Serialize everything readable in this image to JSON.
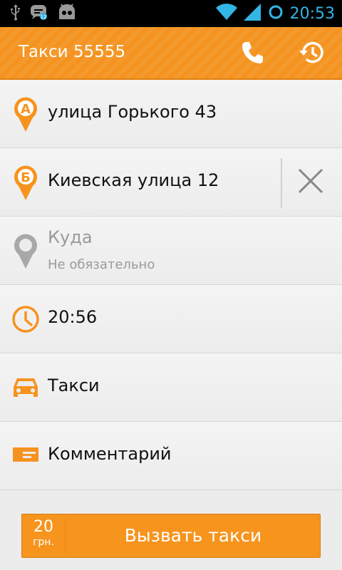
{
  "status_bar": {
    "time": "20:53",
    "icons": [
      "usb-icon",
      "chat-notification-icon",
      "android-icon",
      "wifi-icon",
      "signal-icon",
      "sync-icon"
    ]
  },
  "action_bar": {
    "title": "Такси 55555",
    "actions": [
      "phone-icon",
      "history-icon"
    ]
  },
  "rows": {
    "from": {
      "badge": "А",
      "text": "улица Горького 43"
    },
    "via": {
      "badge": "Б",
      "text": "Киевская улица 12"
    },
    "to": {
      "label": "Куда",
      "hint": "Не обязательно"
    },
    "time": {
      "text": "20:56"
    },
    "car": {
      "text": "Такси"
    },
    "comment": {
      "text": "Комментарий"
    }
  },
  "call": {
    "price": "20",
    "currency": "грн.",
    "label": "Вызвать такси"
  },
  "colors": {
    "accent": "#f6931f",
    "status_icons": "#33b5e5",
    "muted_pin": "#a8a8a8"
  }
}
